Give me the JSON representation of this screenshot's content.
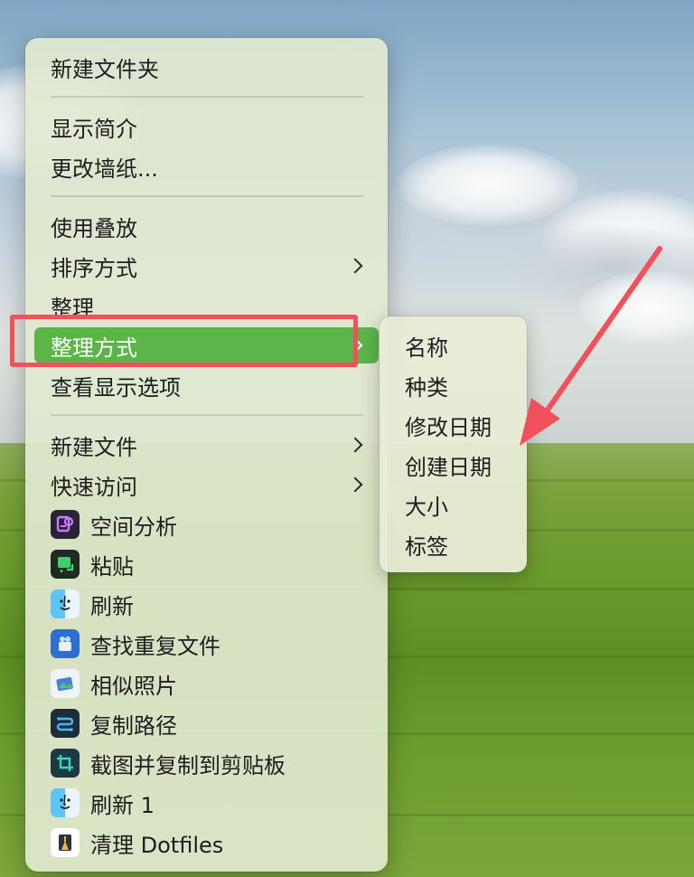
{
  "menu": {
    "items": [
      {
        "label": "新建文件夹"
      },
      {
        "label": "显示简介"
      },
      {
        "label": "更改墙纸..."
      },
      {
        "label": "使用叠放"
      },
      {
        "label": "排序方式"
      },
      {
        "label": "整理"
      },
      {
        "label": "整理方式"
      },
      {
        "label": "查看显示选项"
      },
      {
        "label": "新建文件"
      },
      {
        "label": "快速访问"
      }
    ],
    "apps": [
      {
        "label": "空间分析",
        "icon": "disk-analyzer-icon"
      },
      {
        "label": "粘贴",
        "icon": "clipboard-icon"
      },
      {
        "label": "刷新",
        "icon": "finder-icon"
      },
      {
        "label": "查找重复文件",
        "icon": "duplicate-finder-icon"
      },
      {
        "label": "相似照片",
        "icon": "photos-icon"
      },
      {
        "label": "复制路径",
        "icon": "copy-path-icon"
      },
      {
        "label": "截图并复制到剪贴板",
        "icon": "crop-screenshot-icon"
      },
      {
        "label": "刷新 1",
        "icon": "finder-icon"
      },
      {
        "label": "清理 Dotfiles",
        "icon": "cleaner-icon"
      }
    ]
  },
  "submenu": {
    "items": [
      {
        "label": "名称"
      },
      {
        "label": "种类"
      },
      {
        "label": "修改日期"
      },
      {
        "label": "创建日期"
      },
      {
        "label": "大小"
      },
      {
        "label": "标签"
      }
    ]
  },
  "colors": {
    "highlight": "#5cb548",
    "annotation": "#f0515a"
  }
}
